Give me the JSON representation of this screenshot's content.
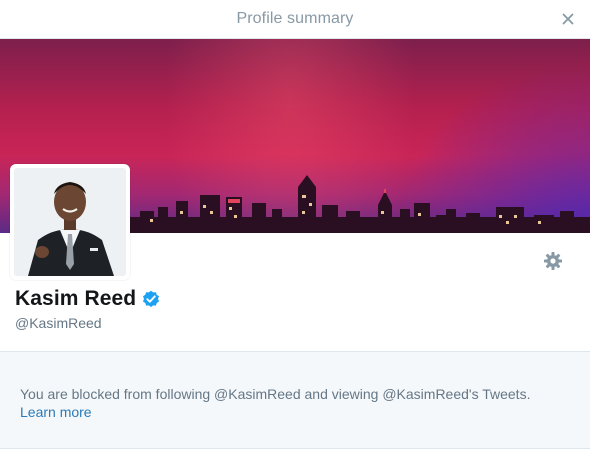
{
  "dialog": {
    "title": "Profile summary",
    "close_icon": "close-icon"
  },
  "profile": {
    "name": "Kasim Reed",
    "handle": "@KasimReed",
    "verified": true,
    "verified_color": "#1da1f2",
    "banner_icon": "city-skyline-image",
    "avatar_icon": "profile-photo"
  },
  "actions": {
    "settings_icon": "gear-icon"
  },
  "notice": {
    "message": "You are blocked from following @KasimReed and viewing @KasimReed's Tweets.",
    "link_label": "Learn more",
    "link_color": "#2b7bb9"
  }
}
